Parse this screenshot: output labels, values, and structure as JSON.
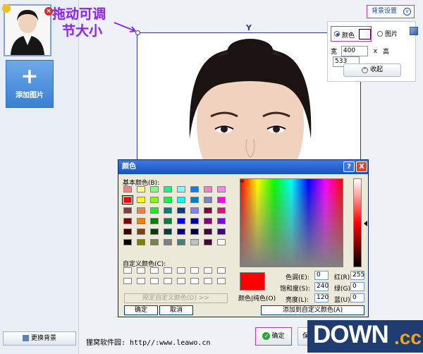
{
  "sidebar": {
    "add_picture": "添加图片",
    "change_background": "更换背景"
  },
  "annotation": {
    "line1": "拖动可调",
    "line2": "节大小"
  },
  "bg_settings": {
    "button": "背景设置",
    "color_label": "颜色",
    "picture_label": "图片",
    "width_label": "宽",
    "width_value": "400",
    "height_label": "高",
    "height_value": "533",
    "x_sep": "x",
    "collapse": "收起"
  },
  "color_dialog": {
    "title": "颜色",
    "help": "?",
    "close": "X",
    "basic_label": "基本颜色(B):",
    "custom_label": "自定义颜色(C):",
    "define_custom": "规定自定义颜色(D) >>",
    "ok": "确定",
    "cancel": "取消",
    "preview_label": "颜色|纯色(O)",
    "hue_label": "色调(E):",
    "hue": "0",
    "sat_label": "饱和度(S):",
    "sat": "240",
    "lum_label": "亮度(L):",
    "lum": "120",
    "red_label": "红(R):",
    "red": "255",
    "green_label": "绿(G):",
    "green": "0",
    "blue_label": "蓝(U):",
    "blue": "0",
    "add_custom": "添加到自定义颜色(A)",
    "basic_colors": [
      "#ff8080",
      "#ffff80",
      "#80ff80",
      "#00ff80",
      "#80ffff",
      "#0080ff",
      "#ff80c0",
      "#ff80ff",
      "#ff0000",
      "#ffff00",
      "#80ff00",
      "#00ff40",
      "#00ffff",
      "#0080c0",
      "#8080c0",
      "#ff00ff",
      "#804040",
      "#ff8040",
      "#00ff00",
      "#008080",
      "#004080",
      "#8080ff",
      "#800040",
      "#ff0080",
      "#800000",
      "#ff8000",
      "#008000",
      "#008040",
      "#0000ff",
      "#0000a0",
      "#800080",
      "#8000ff",
      "#400000",
      "#804000",
      "#004000",
      "#004040",
      "#000080",
      "#000040",
      "#400040",
      "#400080",
      "#000000",
      "#808000",
      "#808040",
      "#808080",
      "#408080",
      "#c0c0c0",
      "#400040",
      "#ffffff"
    ]
  },
  "footer": {
    "site_text": "狸窝软件园: http//:www.leawo.cn",
    "confirm": "确定",
    "save": "保存"
  },
  "watermark": {
    "main": "DOWN",
    "suffix": ".cc"
  }
}
